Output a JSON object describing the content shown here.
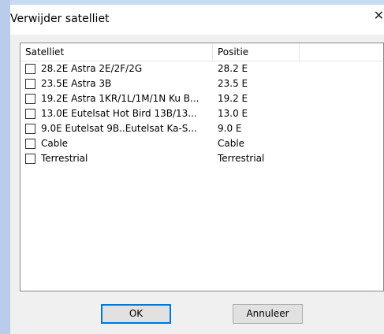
{
  "window": {
    "title": "Verwijder satelliet",
    "close_icon": "close-icon"
  },
  "list": {
    "columns": [
      "Satelliet",
      "Positie"
    ],
    "rows": [
      {
        "name": "28.2E Astra 2E/2F/2G",
        "position": "28.2 E",
        "checked": false
      },
      {
        "name": "23.5E Astra 3B",
        "position": "23.5 E",
        "checked": false
      },
      {
        "name": "19.2E Astra 1KR/1L/1M/1N Ku B...",
        "position": "19.2 E",
        "checked": false
      },
      {
        "name": "13.0E Eutelsat Hot Bird 13B/13...",
        "position": "13.0 E",
        "checked": false
      },
      {
        "name": "9.0E Eutelsat 9B..Eutelsat Ka-S...",
        "position": "9.0 E",
        "checked": false
      },
      {
        "name": "Cable",
        "position": "Cable",
        "checked": false
      },
      {
        "name": "Terrestrial",
        "position": "Terrestrial",
        "checked": false
      }
    ]
  },
  "buttons": {
    "ok": "OK",
    "cancel": "Annuleer"
  }
}
